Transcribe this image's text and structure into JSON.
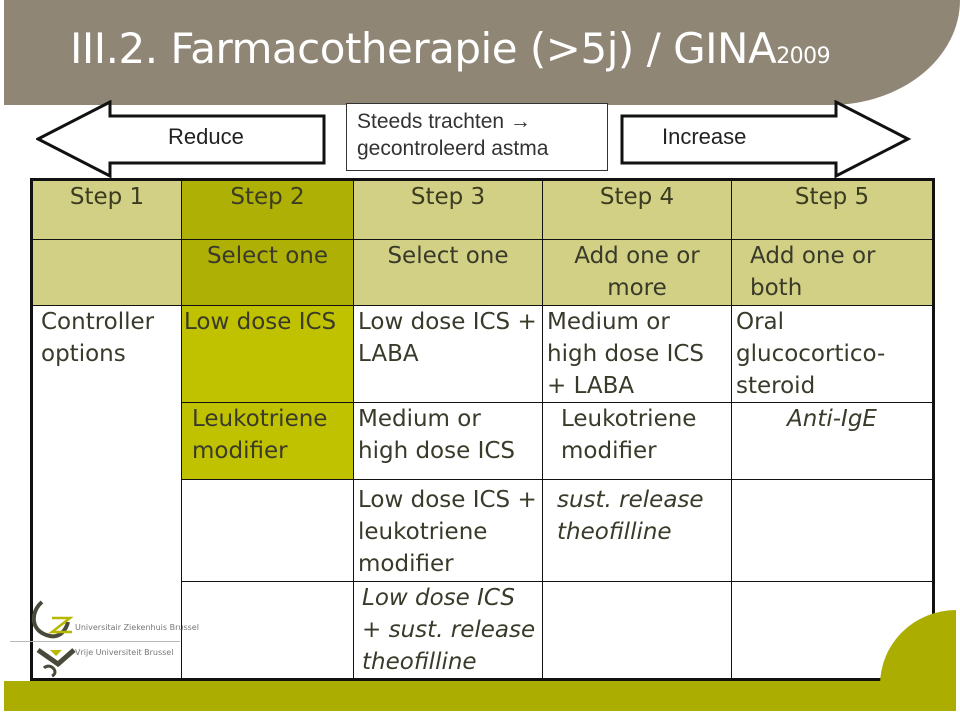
{
  "title": {
    "main": "III.2. Farmacotherapie (>5j) / GINA",
    "suffix": "2009"
  },
  "arrows": {
    "reduce": "Reduce",
    "increase": "Increase"
  },
  "note": {
    "line1": "Steeds trachten →",
    "line2": "gecontroleerd astma"
  },
  "steps": [
    "Step 1",
    "Step 2",
    "Step 3",
    "Step 4",
    "Step 5"
  ],
  "select": [
    "",
    "Select one",
    "Select one",
    "Add one or more",
    "Add one or both"
  ],
  "row_label": "Controller options",
  "rows": [
    [
      "Low dose ICS",
      "Low dose ICS + LABA",
      "Medium or high dose ICS + LABA",
      "Oral glucocortico-steroid"
    ],
    [
      "Leukotriene modifier",
      "Medium or high dose ICS",
      "Leukotriene modifier",
      "Anti-IgE"
    ],
    [
      "",
      "Low dose ICS + leukotriene modifier",
      "sust. release theofilline",
      ""
    ],
    [
      "",
      "Low dose ICS + sust. release theofilline",
      "",
      ""
    ]
  ],
  "logos": {
    "uz": "Universitair Ziekenhuis Brussel",
    "vub": "Vrije Universiteit Brussel"
  },
  "colors": {
    "title_band": "#8f8676",
    "step_light": "#d1d084",
    "step_dark": "#aeb006",
    "step2_cells": "#c0c200",
    "footer": "#abae00"
  }
}
